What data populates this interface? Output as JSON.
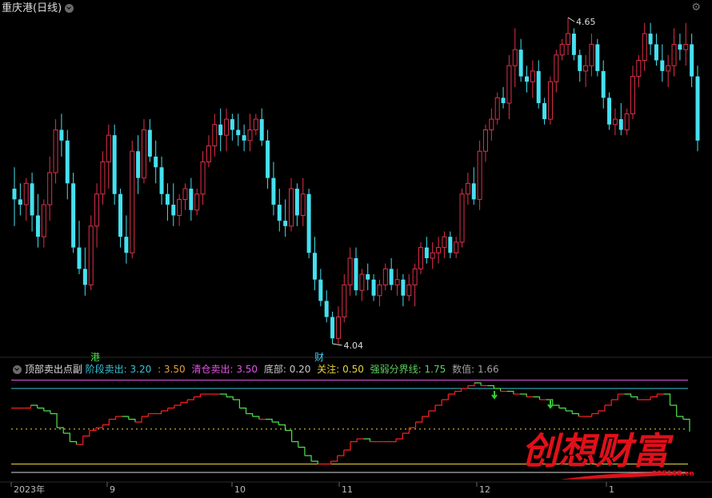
{
  "title": "重庆港(日线)",
  "high_marker": "4.65",
  "low_marker": "4.04",
  "badge_gang": "港",
  "badge_cai": "财",
  "indicator": {
    "name": "顶部卖出点副",
    "items": [
      {
        "label": "阶段卖出:",
        "value": "3.20",
        "color": "#36c3d6"
      },
      {
        "label": ":",
        "value": "3.50",
        "color": "#e9a23b"
      },
      {
        "label": "清仓卖出:",
        "value": "3.50",
        "color": "#e653e6"
      },
      {
        "label": "底部:",
        "value": "0.20",
        "color": "#c9c9c9"
      },
      {
        "label": "关注:",
        "value": "0.50",
        "color": "#e6d440"
      },
      {
        "label": "强弱分界线:",
        "value": "1.75",
        "color": "#5fd05f"
      },
      {
        "label": "数值:",
        "value": "1.66",
        "color": "#a0a0a0"
      }
    ]
  },
  "watermark": "创想财富",
  "watermark_url": "995168.cn",
  "x_labels": [
    "2023年",
    "9",
    "10",
    "11",
    "12",
    "1"
  ],
  "colors": {
    "up": "#e0304a",
    "down": "#45e0f0",
    "line_up": "#ff2020",
    "line_down": "#4fe04f"
  },
  "chart_data": {
    "type": "candlestick",
    "price": {
      "high": 4.65,
      "low": 4.04
    },
    "candles": [
      [
        4.33,
        4.37,
        4.26,
        4.31
      ],
      [
        4.31,
        4.34,
        4.28,
        4.3
      ],
      [
        4.3,
        4.35,
        4.27,
        4.34
      ],
      [
        4.34,
        4.36,
        4.25,
        4.28
      ],
      [
        4.28,
        4.32,
        4.22,
        4.24
      ],
      [
        4.24,
        4.31,
        4.22,
        4.3
      ],
      [
        4.3,
        4.39,
        4.27,
        4.36
      ],
      [
        4.36,
        4.46,
        4.34,
        4.44
      ],
      [
        4.44,
        4.47,
        4.39,
        4.42
      ],
      [
        4.42,
        4.44,
        4.31,
        4.34
      ],
      [
        4.34,
        4.36,
        4.21,
        4.22
      ],
      [
        4.22,
        4.27,
        4.17,
        4.18
      ],
      [
        4.18,
        4.22,
        4.13,
        4.15
      ],
      [
        4.15,
        4.28,
        4.14,
        4.26
      ],
      [
        4.26,
        4.34,
        4.22,
        4.32
      ],
      [
        4.32,
        4.4,
        4.3,
        4.38
      ],
      [
        4.38,
        4.45,
        4.33,
        4.43
      ],
      [
        4.43,
        4.45,
        4.3,
        4.32
      ],
      [
        4.32,
        4.33,
        4.22,
        4.24
      ],
      [
        4.24,
        4.28,
        4.19,
        4.21
      ],
      [
        4.21,
        4.42,
        4.2,
        4.4
      ],
      [
        4.4,
        4.43,
        4.32,
        4.35
      ],
      [
        4.35,
        4.46,
        4.34,
        4.44
      ],
      [
        4.44,
        4.46,
        4.38,
        4.39
      ],
      [
        4.39,
        4.42,
        4.34,
        4.37
      ],
      [
        4.37,
        4.39,
        4.3,
        4.32
      ],
      [
        4.32,
        4.34,
        4.27,
        4.3
      ],
      [
        4.3,
        4.34,
        4.26,
        4.28
      ],
      [
        4.28,
        4.32,
        4.26,
        4.31
      ],
      [
        4.31,
        4.34,
        4.29,
        4.33
      ],
      [
        4.33,
        4.35,
        4.27,
        4.29
      ],
      [
        4.29,
        4.33,
        4.28,
        4.32
      ],
      [
        4.32,
        4.4,
        4.3,
        4.38
      ],
      [
        4.38,
        4.43,
        4.37,
        4.41
      ],
      [
        4.41,
        4.47,
        4.39,
        4.45
      ],
      [
        4.45,
        4.48,
        4.4,
        4.43
      ],
      [
        4.43,
        4.48,
        4.4,
        4.46
      ],
      [
        4.46,
        4.47,
        4.42,
        4.44
      ],
      [
        4.44,
        4.47,
        4.41,
        4.43
      ],
      [
        4.43,
        4.45,
        4.4,
        4.42
      ],
      [
        4.42,
        4.47,
        4.4,
        4.44
      ],
      [
        4.44,
        4.47,
        4.43,
        4.46
      ],
      [
        4.46,
        4.48,
        4.41,
        4.42
      ],
      [
        4.42,
        4.44,
        4.33,
        4.35
      ],
      [
        4.35,
        4.38,
        4.28,
        4.3
      ],
      [
        4.3,
        4.33,
        4.25,
        4.27
      ],
      [
        4.27,
        4.31,
        4.24,
        4.26
      ],
      [
        4.26,
        4.35,
        4.25,
        4.33
      ],
      [
        4.33,
        4.34,
        4.26,
        4.28
      ],
      [
        4.28,
        4.35,
        4.26,
        4.32
      ],
      [
        4.32,
        4.33,
        4.2,
        4.21
      ],
      [
        4.21,
        4.24,
        4.14,
        4.16
      ],
      [
        4.16,
        4.18,
        4.11,
        4.12
      ],
      [
        4.12,
        4.14,
        4.08,
        4.09
      ],
      [
        4.09,
        4.1,
        4.04,
        4.05
      ],
      [
        4.05,
        4.11,
        4.04,
        4.09
      ],
      [
        4.09,
        4.17,
        4.08,
        4.15
      ],
      [
        4.15,
        4.22,
        4.13,
        4.2
      ],
      [
        4.2,
        4.22,
        4.13,
        4.14
      ],
      [
        4.14,
        4.18,
        4.12,
        4.17
      ],
      [
        4.17,
        4.19,
        4.14,
        4.16
      ],
      [
        4.16,
        4.17,
        4.12,
        4.13
      ],
      [
        4.13,
        4.16,
        4.11,
        4.15
      ],
      [
        4.15,
        4.19,
        4.14,
        4.18
      ],
      [
        4.18,
        4.2,
        4.14,
        4.15
      ],
      [
        4.15,
        4.18,
        4.13,
        4.16
      ],
      [
        4.16,
        4.17,
        4.11,
        4.13
      ],
      [
        4.13,
        4.17,
        4.12,
        4.15
      ],
      [
        4.15,
        4.19,
        4.11,
        4.18
      ],
      [
        4.18,
        4.23,
        4.17,
        4.22
      ],
      [
        4.22,
        4.24,
        4.19,
        4.2
      ],
      [
        4.2,
        4.23,
        4.18,
        4.21
      ],
      [
        4.21,
        4.24,
        4.19,
        4.22
      ],
      [
        4.22,
        4.25,
        4.2,
        4.24
      ],
      [
        4.24,
        4.25,
        4.2,
        4.21
      ],
      [
        4.21,
        4.24,
        4.2,
        4.23
      ],
      [
        4.23,
        4.33,
        4.22,
        4.32
      ],
      [
        4.32,
        4.36,
        4.3,
        4.34
      ],
      [
        4.34,
        4.37,
        4.3,
        4.31
      ],
      [
        4.31,
        4.42,
        4.29,
        4.4
      ],
      [
        4.4,
        4.45,
        4.38,
        4.44
      ],
      [
        4.44,
        4.48,
        4.42,
        4.46
      ],
      [
        4.46,
        4.51,
        4.45,
        4.5
      ],
      [
        4.5,
        4.52,
        4.48,
        4.49
      ],
      [
        4.49,
        4.58,
        4.46,
        4.56
      ],
      [
        4.56,
        4.63,
        4.52,
        4.59
      ],
      [
        4.59,
        4.61,
        4.53,
        4.54
      ],
      [
        4.54,
        4.56,
        4.51,
        4.53
      ],
      [
        4.53,
        4.57,
        4.5,
        4.55
      ],
      [
        4.55,
        4.57,
        4.48,
        4.49
      ],
      [
        4.49,
        4.5,
        4.45,
        4.46
      ],
      [
        4.46,
        4.54,
        4.45,
        4.53
      ],
      [
        4.53,
        4.59,
        4.51,
        4.58
      ],
      [
        4.58,
        4.61,
        4.57,
        4.6
      ],
      [
        4.6,
        4.65,
        4.58,
        4.62
      ],
      [
        4.62,
        4.63,
        4.57,
        4.58
      ],
      [
        4.58,
        4.59,
        4.53,
        4.55
      ],
      [
        4.55,
        4.58,
        4.52,
        4.56
      ],
      [
        4.56,
        4.62,
        4.54,
        4.6
      ],
      [
        4.6,
        4.61,
        4.54,
        4.55
      ],
      [
        4.55,
        4.57,
        4.48,
        4.5
      ],
      [
        4.5,
        4.51,
        4.44,
        4.45
      ],
      [
        4.45,
        4.48,
        4.43,
        4.46
      ],
      [
        4.46,
        4.49,
        4.43,
        4.44
      ],
      [
        4.44,
        4.48,
        4.43,
        4.47
      ],
      [
        4.47,
        4.56,
        4.46,
        4.54
      ],
      [
        4.54,
        4.58,
        4.52,
        4.57
      ],
      [
        4.57,
        4.64,
        4.55,
        4.62
      ],
      [
        4.62,
        4.64,
        4.58,
        4.6
      ],
      [
        4.6,
        4.62,
        4.56,
        4.57
      ],
      [
        4.57,
        4.6,
        4.53,
        4.55
      ],
      [
        4.55,
        4.58,
        4.52,
        4.56
      ],
      [
        4.56,
        4.63,
        4.54,
        4.6
      ],
      [
        4.6,
        4.62,
        4.57,
        4.59
      ],
      [
        4.59,
        4.64,
        4.56,
        4.6
      ],
      [
        4.6,
        4.62,
        4.52,
        4.54
      ],
      [
        4.54,
        4.56,
        4.4,
        4.42
      ]
    ],
    "indicator": {
      "ylim": [
        0,
        3.6
      ],
      "levels": {
        "stage_sell": 3.2,
        "clear_sell": 3.5,
        "bottom": 0.2,
        "focus": 0.5,
        "strength_line": 1.75
      },
      "values": [
        2.5,
        2.5,
        2.5,
        2.6,
        2.5,
        2.4,
        2.3,
        1.8,
        1.6,
        1.3,
        1.2,
        1.5,
        1.7,
        1.8,
        1.9,
        2.1,
        2.2,
        2.2,
        2.1,
        2.0,
        2.2,
        2.3,
        2.3,
        2.4,
        2.5,
        2.6,
        2.7,
        2.8,
        2.9,
        3.0,
        3.0,
        3.0,
        3.0,
        2.9,
        2.8,
        2.5,
        2.3,
        2.2,
        2.1,
        2.1,
        2.0,
        1.9,
        1.7,
        1.3,
        1.1,
        0.8,
        0.6,
        0.5,
        0.5,
        0.6,
        0.8,
        1.0,
        1.3,
        1.4,
        1.4,
        1.3,
        1.3,
        1.3,
        1.3,
        1.4,
        1.6,
        1.8,
        2.0,
        2.2,
        2.4,
        2.6,
        2.8,
        3.0,
        3.1,
        3.2,
        3.3,
        3.4,
        3.3,
        3.3,
        3.2,
        3.1,
        3.1,
        3.0,
        3.0,
        2.9,
        2.9,
        2.8,
        2.8,
        2.6,
        2.5,
        2.4,
        2.3,
        2.2,
        2.2,
        2.3,
        2.4,
        2.6,
        2.8,
        3.0,
        3.0,
        2.9,
        2.8,
        2.8,
        2.9,
        3.0,
        3.0,
        2.6,
        2.2,
        2.1,
        1.66
      ]
    }
  }
}
